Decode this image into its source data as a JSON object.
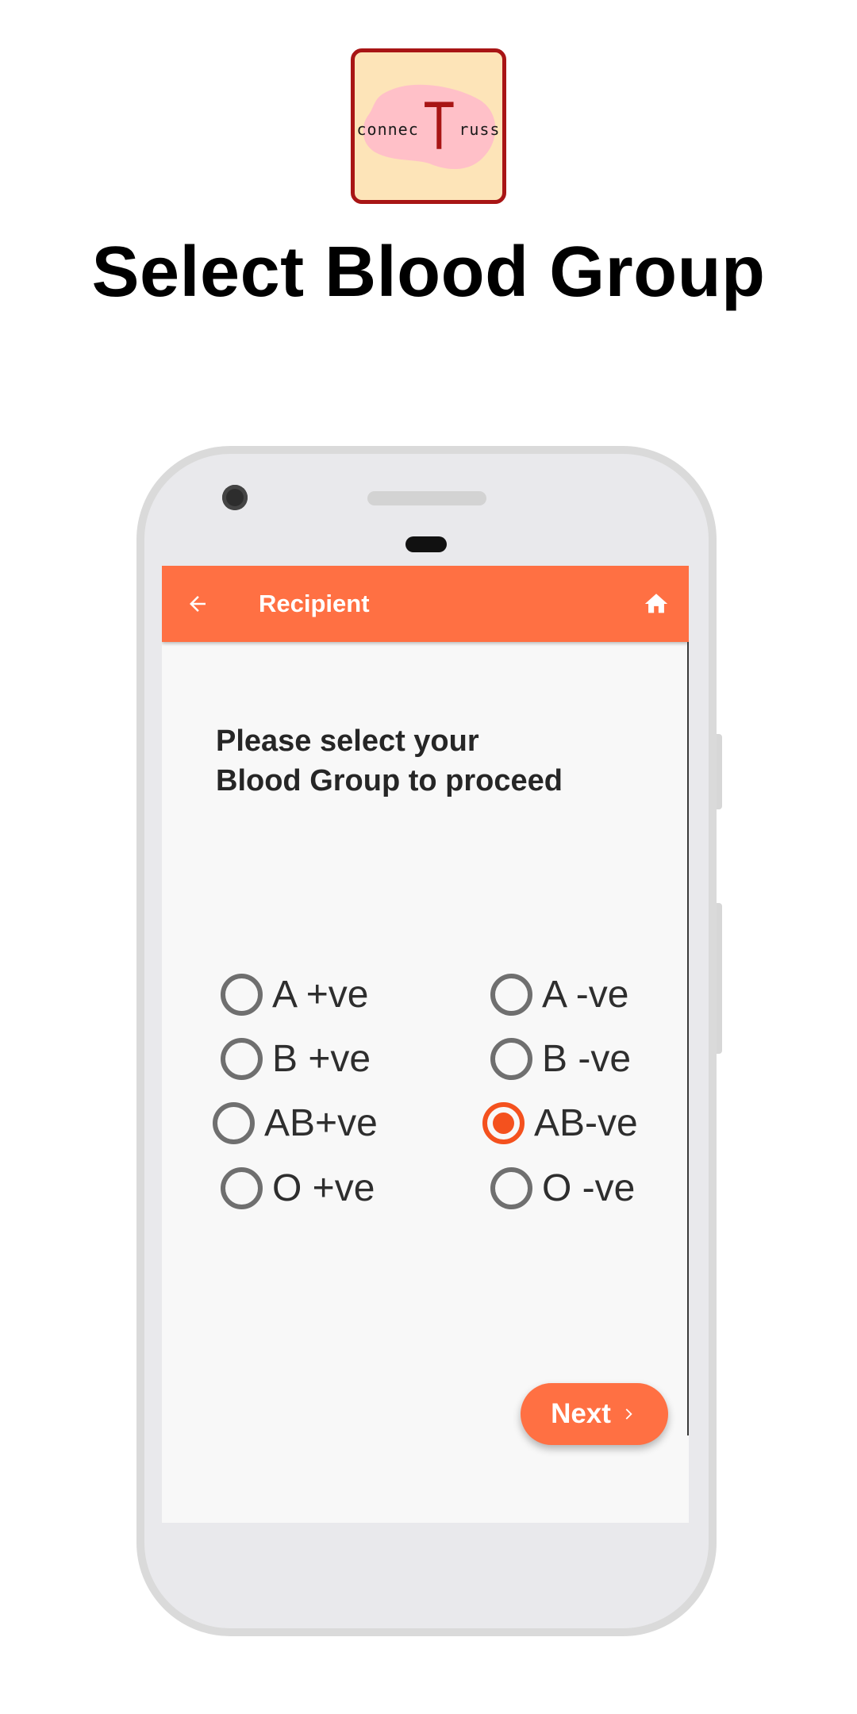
{
  "branding": {
    "logo_text_left": "connec",
    "logo_text_big": "T",
    "logo_text_right": "russ",
    "colors": {
      "logo_border": "#a81515",
      "logo_bg": "#fde4b8",
      "logo_blob": "#ffc0c8"
    }
  },
  "page": {
    "title": "Select Blood Group"
  },
  "app": {
    "appbar": {
      "title": "Recipient",
      "back_icon": "arrow-left-icon",
      "home_icon": "home-icon"
    },
    "prompt": {
      "line1": "Please select your",
      "line2": "Blood Group to proceed"
    },
    "blood_groups": [
      {
        "label": "A +ve",
        "selected": false
      },
      {
        "label": "A -ve",
        "selected": false
      },
      {
        "label": "B +ve",
        "selected": false
      },
      {
        "label": "B -ve",
        "selected": false
      },
      {
        "label": "AB+ve",
        "selected": false
      },
      {
        "label": "AB-ve",
        "selected": true
      },
      {
        "label": "O +ve",
        "selected": false
      },
      {
        "label": "O -ve",
        "selected": false
      }
    ],
    "next_button": {
      "label": "Next",
      "icon": "chevron-right-icon"
    },
    "colors": {
      "accent": "#ff7043",
      "radio_checked": "#f4511e",
      "radio_unchecked": "#6f6f6f"
    }
  }
}
